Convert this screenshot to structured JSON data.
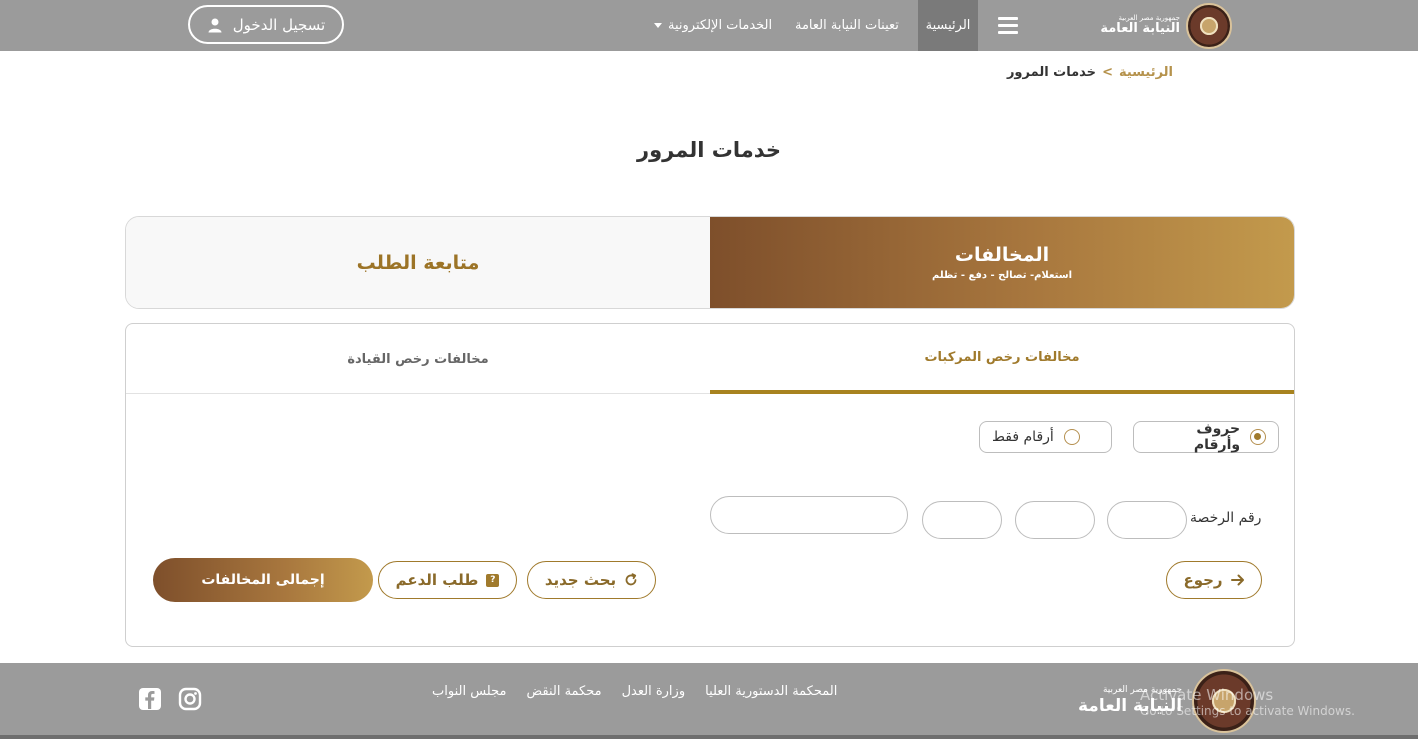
{
  "header": {
    "brand_sub": "جمهورية مصر العربية",
    "brand_title": "النيابة العامة",
    "login_label": "تسجيل الدخول",
    "nav": {
      "home": "الرئيسية",
      "appointments": "تعينات النيابة العامة",
      "eservices": "الخدمات الإلكترونية"
    }
  },
  "breadcrumb": {
    "home": "الرئيسية",
    "sep": ">",
    "current": "خدمات المرور"
  },
  "page_title": "خدمات المرور",
  "main_tabs": {
    "violations_title": "المخالفات",
    "violations_sub": "استعلام- تصالح - دفع - تظلم",
    "follow_up": "متابعة الطلب"
  },
  "sub_tabs": {
    "vehicles": "مخالفات رخص المركبات",
    "driving": "مخالفات رخص القيادة"
  },
  "form": {
    "radio_letters": "حروف وأرقام",
    "radio_numbers": "أرقام فقط",
    "license_label": "رقم الرخصة",
    "plate_1": "",
    "plate_2": "",
    "plate_3": "",
    "plate_4": ""
  },
  "buttons": {
    "back": "رجوع",
    "new_search": "بحث جديد",
    "support": "طلب الدعم",
    "total": "إجمالى المخالفات"
  },
  "footer": {
    "brand_sub": "جمهورية مصر العربية",
    "brand_title": "النيابة العامة",
    "links": [
      "المحكمة الدستورية العليا",
      "وزارة العدل",
      "محكمة النقض",
      "مجلس النواب"
    ]
  },
  "watermark": {
    "line1": "Activate Windows",
    "line2": "Go to Settings to activate Windows."
  },
  "colors": {
    "topbar": "#9b9b9b",
    "accent_gold": "#a07a2c",
    "gradient_dark": "#7e4f2b",
    "gradient_light": "#c39a4c"
  },
  "icons": [
    "user-icon",
    "menu-icon",
    "caret-down-icon",
    "arrow-right-icon",
    "refresh-icon",
    "question-icon",
    "facebook-icon",
    "instagram-icon",
    "seal-logo"
  ]
}
